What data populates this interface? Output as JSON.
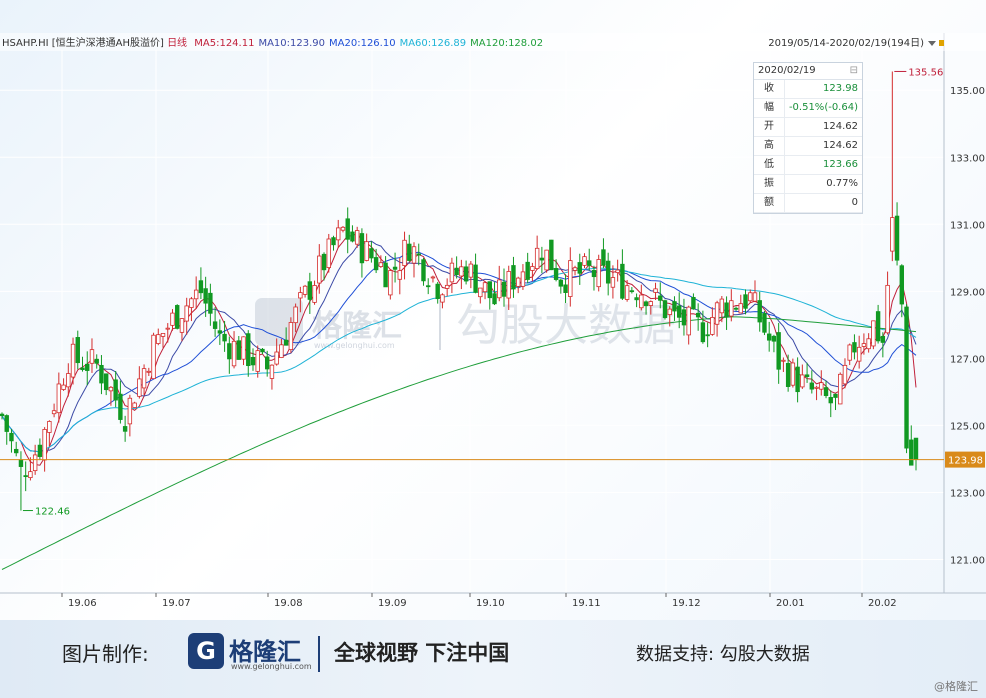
{
  "header": {
    "symbol": "HSAHP.HI",
    "name": "[恒生沪深港通AH股溢价]",
    "period": "日线",
    "ma_labels": [
      {
        "text": "MA5:124.11",
        "color": "#c0203a"
      },
      {
        "text": "MA10:123.90",
        "color": "#3c4aa6"
      },
      {
        "text": "MA20:126.10",
        "color": "#1f4fd6"
      },
      {
        "text": "MA60:126.89",
        "color": "#1fb3d6"
      },
      {
        "text": "MA120:128.02",
        "color": "#1f9e3a"
      }
    ],
    "range": "2019/05/14-2020/02/19(194日)"
  },
  "ohlc_panel": {
    "date": "2020/02/19",
    "rows": [
      {
        "k": "收",
        "v": "123.98",
        "color": "#1a8f3a"
      },
      {
        "k": "幅",
        "v": "-0.51%(-0.64)",
        "color": "#1a8f3a"
      },
      {
        "k": "开",
        "v": "124.62",
        "color": "#333333"
      },
      {
        "k": "高",
        "v": "124.62",
        "color": "#333333"
      },
      {
        "k": "低",
        "v": "123.66",
        "color": "#1a8f3a"
      },
      {
        "k": "振",
        "v": "0.77%",
        "color": "#333333"
      },
      {
        "k": "额",
        "v": "0",
        "color": "#333333"
      }
    ]
  },
  "watermark": {
    "brand": "格隆汇",
    "url": "www.gelonghui.com",
    "text": "勾股大数据"
  },
  "footer": {
    "credit": "图片制作:",
    "logo_text": "格隆汇",
    "logo_url": "www.gelonghui.com",
    "slogan": "全球视野 下注中国",
    "data_support": "数据支持: 勾股大数据",
    "corner": "@格隆汇"
  },
  "chart_data": {
    "type": "candlestick",
    "y_ticks": [
      121.0,
      123.0,
      125.0,
      127.0,
      129.0,
      131.0,
      133.0,
      135.0
    ],
    "ylim": [
      120.0,
      136.2
    ],
    "x_ticks": [
      "19.06",
      "19.07",
      "19.08",
      "19.09",
      "19.10",
      "19.11",
      "19.12",
      "20.01",
      "20.02"
    ],
    "last_price": 123.98,
    "annotations": [
      {
        "label": "135.56",
        "kind": "high"
      },
      {
        "label": "122.46",
        "kind": "low"
      },
      {
        "label": "123.98",
        "kind": "last"
      }
    ],
    "colors": {
      "up": "#d42c2c",
      "down": "#119922",
      "last_line": "#d98a1a"
    },
    "key_points": {
      "start": "2019/05/14",
      "low": 122.46,
      "mid_july_high": 131.3,
      "aug_high": 132.8,
      "sept_high": 131.2,
      "dec_low": 125.1,
      "feb_peak": 135.56,
      "end": "2020/02/19",
      "end_close": 123.98
    }
  }
}
